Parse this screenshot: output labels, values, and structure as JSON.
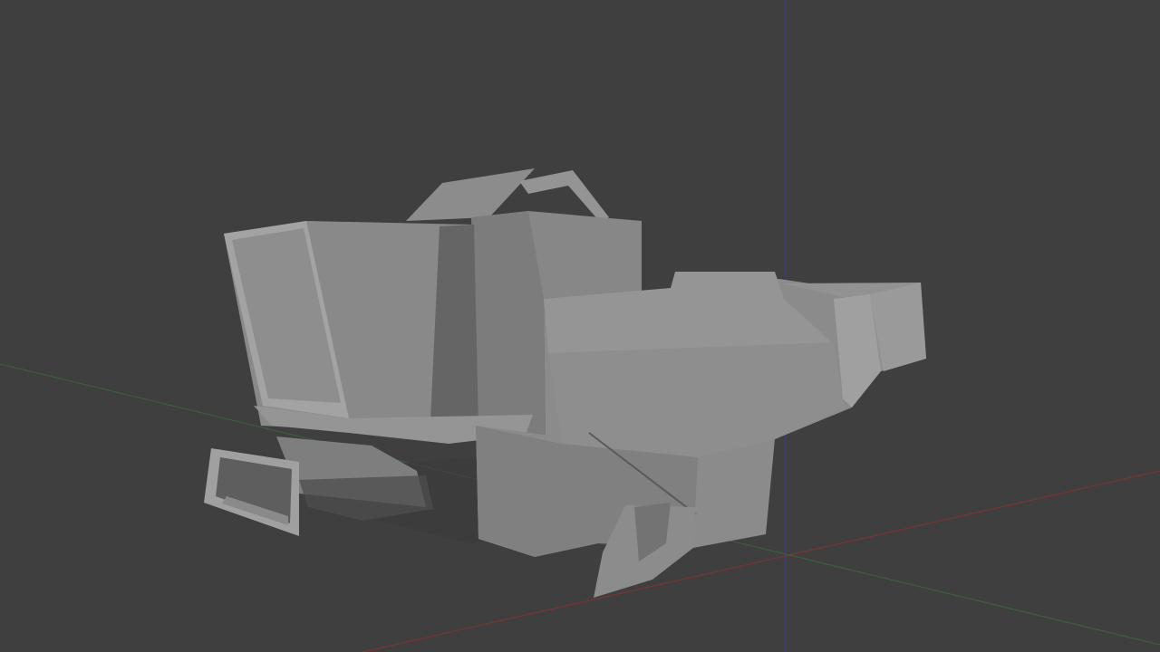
{
  "viewport": {
    "background": "#3f3f3f",
    "view_mode": "solid",
    "grid": false,
    "text_overlays": []
  },
  "axes": {
    "x_axis_color": "#7a3434",
    "y_axis_color": "#3d6b3d",
    "z_axis_color": "#3a3a8c"
  },
  "model": {
    "type": "low-poly mesh",
    "shading": "solid grey",
    "base_color": "#8a8a8a",
    "highlight_color": "#a2a2a2",
    "shadow_color": "#4a4a4a"
  }
}
